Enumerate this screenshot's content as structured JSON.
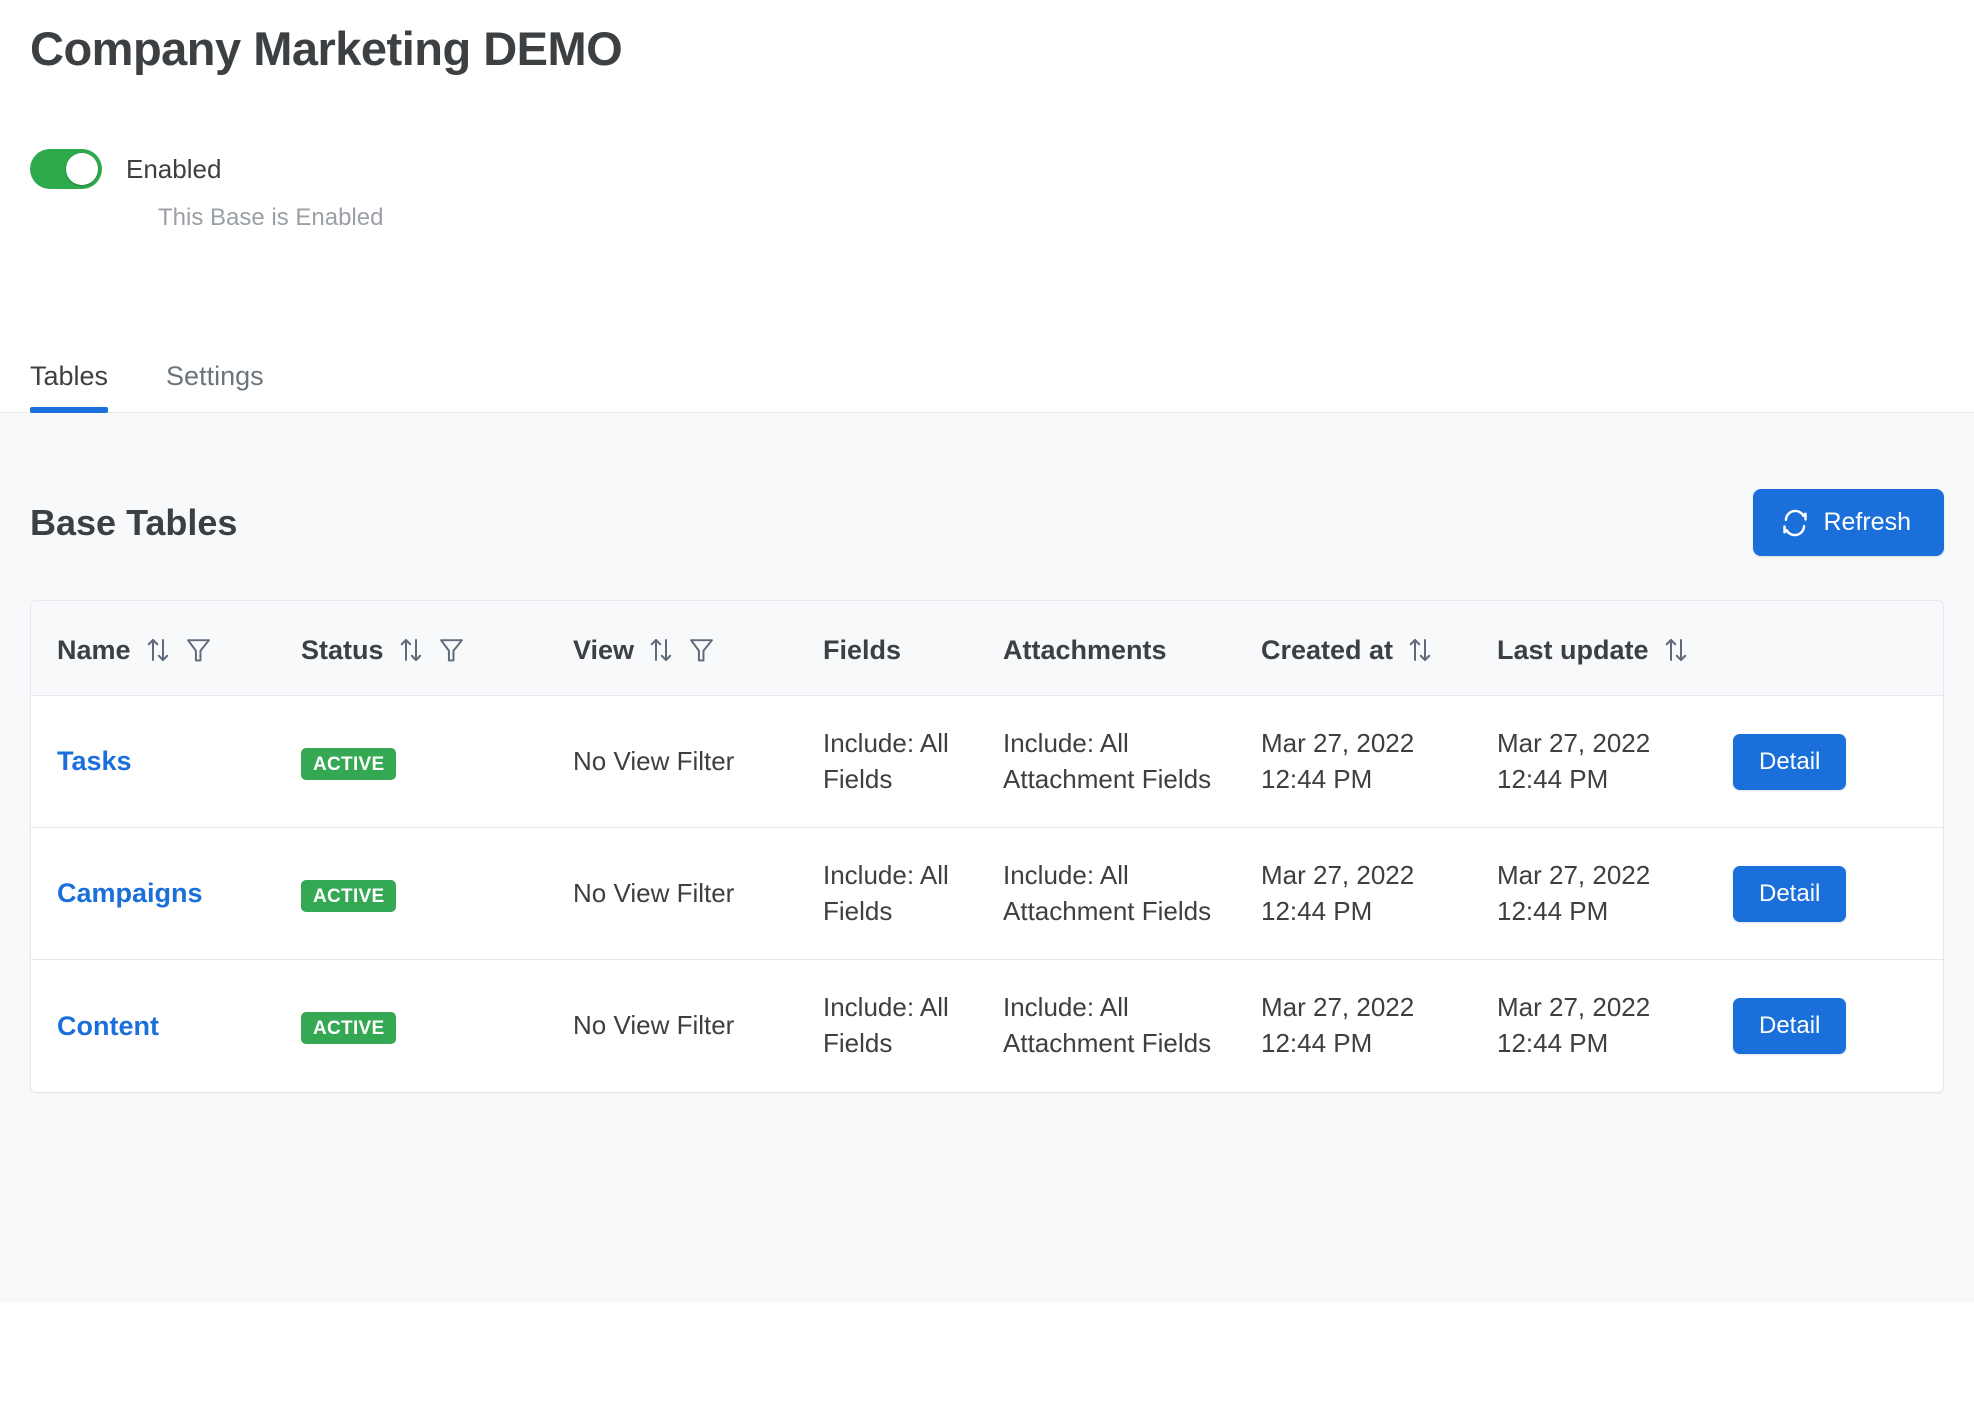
{
  "header": {
    "title": "Company Marketing DEMO"
  },
  "enable_toggle": {
    "state": "on",
    "label": "Enabled",
    "help_text": "This Base is Enabled",
    "on_color": "#2eaa4d"
  },
  "tabs": [
    {
      "label": "Tables",
      "active": true
    },
    {
      "label": "Settings",
      "active": false
    }
  ],
  "section": {
    "title": "Base Tables",
    "refresh_label": "Refresh",
    "refresh_icon": "refresh-icon",
    "accent_color": "#1a6fdb"
  },
  "table": {
    "columns": [
      {
        "label": "Name",
        "sortable": true,
        "filterable": true
      },
      {
        "label": "Status",
        "sortable": true,
        "filterable": true
      },
      {
        "label": "View",
        "sortable": true,
        "filterable": true
      },
      {
        "label": "Fields",
        "sortable": false,
        "filterable": false
      },
      {
        "label": "Attachments",
        "sortable": false,
        "filterable": false
      },
      {
        "label": "Created at",
        "sortable": true,
        "filterable": false
      },
      {
        "label": "Last update",
        "sortable": true,
        "filterable": false
      },
      {
        "label": "",
        "sortable": false,
        "filterable": false
      }
    ],
    "rows": [
      {
        "name": "Tasks",
        "status": "ACTIVE",
        "view": "No View Filter",
        "fields": "Include: All Fields",
        "attachments": "Include: All Attachment Fields",
        "created_date": "Mar 27, 2022",
        "created_time": "12:44 PM",
        "updated_date": "Mar 27, 2022",
        "updated_time": "12:44 PM",
        "action_label": "Detail"
      },
      {
        "name": "Campaigns",
        "status": "ACTIVE",
        "view": "No View Filter",
        "fields": "Include: All Fields",
        "attachments": "Include: All Attachment Fields",
        "created_date": "Mar 27, 2022",
        "created_time": "12:44 PM",
        "updated_date": "Mar 27, 2022",
        "updated_time": "12:44 PM",
        "action_label": "Detail"
      },
      {
        "name": "Content",
        "status": "ACTIVE",
        "view": "No View Filter",
        "fields": "Include: All Fields",
        "attachments": "Include: All Attachment Fields",
        "created_date": "Mar 27, 2022",
        "created_time": "12:44 PM",
        "updated_date": "Mar 27, 2022",
        "updated_time": "12:44 PM",
        "action_label": "Detail"
      }
    ],
    "status_badge_color": "#34a853",
    "link_color": "#1a6fdb"
  },
  "icons": {
    "sort": "sort-arrows-icon",
    "filter": "filter-funnel-icon"
  }
}
